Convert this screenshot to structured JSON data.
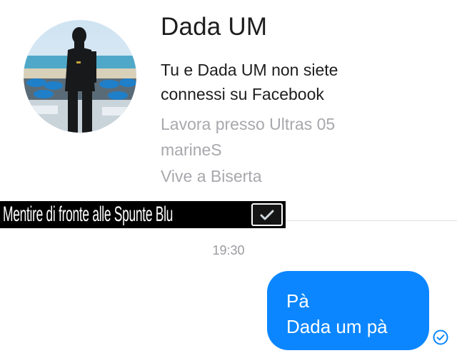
{
  "contact": {
    "name": "Dada UM",
    "connection_line": "Tu e Dada UM non siete connessi su Facebook",
    "work": "Lavora presso Ultras 05 marineS",
    "lives": "Vive a Biserta",
    "avatar_icon": "profile-photo"
  },
  "banner": {
    "text": "Mentire di fronte alle Spunte Blu",
    "icon": "checkmark-box-icon"
  },
  "conversation": {
    "timestamp": "19:30",
    "messages": [
      {
        "line1": "Pà",
        "line2": "Dada um pà",
        "status_icon": "read-check-icon"
      }
    ]
  },
  "colors": {
    "bubble": "#0b86ff",
    "secondary_text": "#a8a8ad",
    "timestamp": "#9a9aa0"
  }
}
